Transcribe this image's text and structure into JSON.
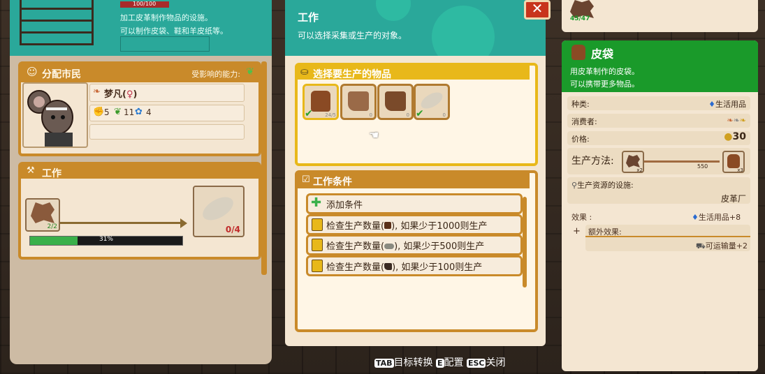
{
  "left_panel": {
    "hp": "100/100",
    "desc_line1": "加工皮革制作物品的设施。",
    "desc_line2": "可以制作皮袋、鞋和羊皮纸等。",
    "assign": {
      "title": "分配市民",
      "affected": "受影响的能力:"
    },
    "citizen": {
      "name": "梦凡(",
      "name_end": ")",
      "stat1": "5",
      "stat2": "11",
      "stat3": "4"
    },
    "work": {
      "title": "工作",
      "input_count": "2/2",
      "output_count": "0/4",
      "progress_label": "31%",
      "progress": 0.31
    }
  },
  "middle_panel": {
    "title": "工作",
    "subtitle": "可以选择采集或生产的对象。",
    "select_title": "选择要生产的物品",
    "items": [
      {
        "icon": "bag-icon",
        "count": "24/5"
      },
      {
        "icon": "boot-icon",
        "count": "0"
      },
      {
        "icon": "boot-icon",
        "count": "0"
      },
      {
        "icon": "scroll-icon",
        "count": "0"
      }
    ],
    "cond_title": "工作条件",
    "add_condition": "添加条件",
    "conditions": [
      {
        "prefix": "检查生产数量(",
        "suffix": "), 如果少于1000则生产"
      },
      {
        "prefix": "检查生产数量(",
        "suffix": "), 如果少于500则生产"
      },
      {
        "prefix": "检查生产数量(",
        "suffix": "), 如果少于100则生产"
      }
    ]
  },
  "hints": {
    "tab_key": "TAB",
    "tab_label": "目标转换",
    "e_key": "E",
    "e_label": "配置",
    "esc_key": "ESC",
    "esc_label": "关闭"
  },
  "right_panel": {
    "top_count": "45/47",
    "title": "皮袋",
    "desc_line1": "用皮革制作的皮袋。",
    "desc_line2": "可以携带更多物品。",
    "category_label": "种类:",
    "category_value": "生活用品",
    "consumer_label": "消费者:",
    "price_label": "价格:",
    "price_value": "30",
    "method_label": "生产方法:",
    "method_in": "x2",
    "method_time": "550",
    "method_out": "x3",
    "facility_label": "生产资源的设施:",
    "facility_value": "皮革厂",
    "effect_label": "效果 :",
    "effect_value": "生活用品+8",
    "extra_label": "额外效果:",
    "extra_value": "可运输量+2"
  },
  "colors": {
    "teal": "#2aa89a",
    "orange": "#c98a2a",
    "gold": "#e8b81a",
    "green": "#1a9a2a",
    "close": "#c8341c"
  }
}
